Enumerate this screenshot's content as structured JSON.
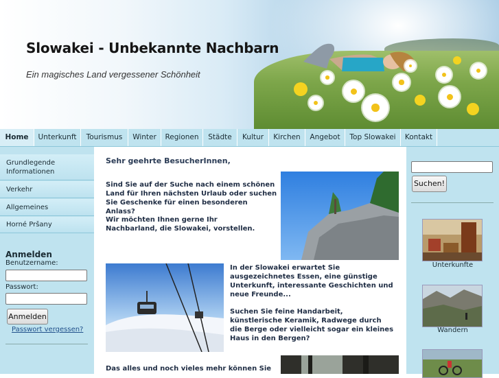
{
  "header": {
    "title": "Slowakei - Unbekannte Nachbarn",
    "subtitle": "Ein magisches Land vergessener Schönheit"
  },
  "nav": {
    "items": [
      {
        "label": "Home"
      },
      {
        "label": "Unterkunft"
      },
      {
        "label": "Tourismus"
      },
      {
        "label": "Winter"
      },
      {
        "label": "Regionen"
      },
      {
        "label": "Städte"
      },
      {
        "label": "Kultur"
      },
      {
        "label": "Kirchen"
      },
      {
        "label": "Angebot"
      },
      {
        "label": "Top Slowakei"
      },
      {
        "label": "Kontakt"
      }
    ]
  },
  "sidebar": {
    "items": [
      {
        "label": "Grundlegende Informationen"
      },
      {
        "label": "Verkehr"
      },
      {
        "label": "Allgemeines"
      },
      {
        "label": "Horné Pršany"
      }
    ]
  },
  "login": {
    "title": "Anmelden",
    "username_label": "Benutzername:",
    "username_value": "",
    "password_label": "Passwort:",
    "password_value": "",
    "submit_label": "Anmelden",
    "forgot_label": "Passwort vergessen?"
  },
  "main": {
    "greeting": "Sehr geehrte BesucherInnen,",
    "para1": "Sind Sie auf der Suche nach einem schönen Land für Ihren nächsten Urlaub oder suchen Sie Geschenke für einen besonderen Anlass?",
    "para2": "Wir möchten Ihnen gerne Ihr Nachbarland, die Slowakei, vorstellen.",
    "para3": "In der Slowakei erwartet Sie ausgezeichnetes Essen, eine günstige Unterkunft, interessante Geschichten und neue Freunde...",
    "para4": "Suchen Sie feine Handarbeit, künstlerische Keramik, Radwege durch die Berge oder vielleicht sogar ein kleines Haus in den Bergen?",
    "para5": "Das alles und noch vieles mehr können Sie"
  },
  "search": {
    "value": "",
    "button_label": "Suchen!"
  },
  "right": {
    "thumbs": [
      {
        "caption": "Unterkunfte"
      },
      {
        "caption": "Wandern"
      },
      {
        "caption": ""
      }
    ]
  },
  "colors": {
    "nav_bg": "#bfe3ef",
    "sidebar_bg": "#bfe3ef",
    "text_dark": "#1f2d44"
  }
}
